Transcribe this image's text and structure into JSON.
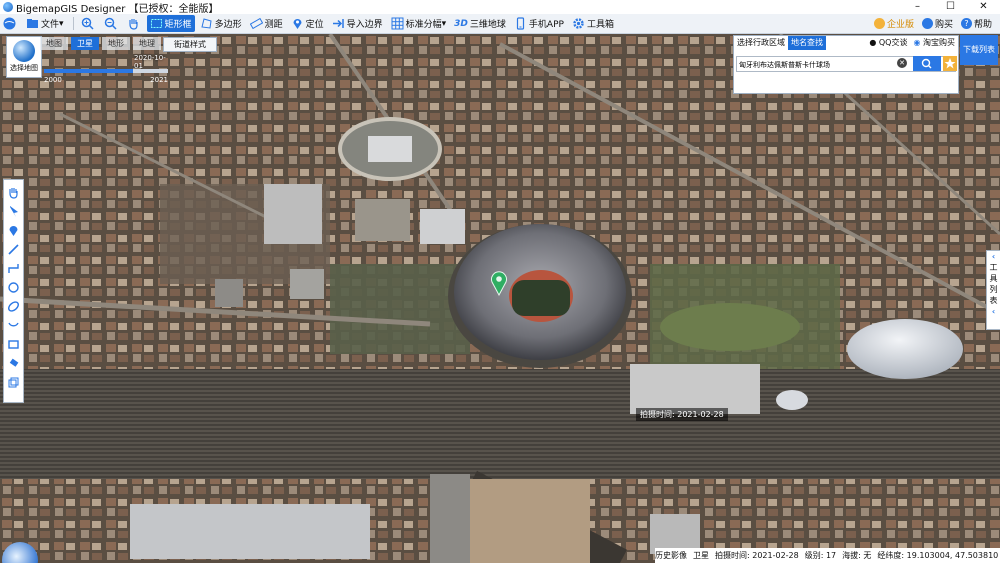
{
  "app": {
    "title": "BigemapGIS Designer 【已授权：全能版】",
    "window_buttons": [
      "–",
      "☐",
      "✕"
    ]
  },
  "toolbar": {
    "file_menu": "文件",
    "items": {
      "rect_select": "矩形框",
      "polygon": "多边形",
      "measure": "测距",
      "locate": "定位",
      "import_boundary": "导入边界",
      "standard_grid": "标准分幅",
      "three_d_label": "3D",
      "three_d": "三维地球",
      "mobile_app": "手机APP",
      "toolbox": "工具箱"
    },
    "right": {
      "enterprise": "企业版",
      "qq": "购买",
      "help": "帮助"
    }
  },
  "map": {
    "switch_label": "选择地图",
    "types": [
      "地图",
      "卫星",
      "地形",
      "地理"
    ],
    "active_type": "卫星",
    "street_style": "街道样式",
    "timeline": {
      "date": "2020-10-01",
      "start": "2000",
      "end": "2021",
      "progress": 0.72
    },
    "capture_label": "拍摄时间: 2021-02-28",
    "compass_label": "3D"
  },
  "search": {
    "tab_region": "选择行政区域",
    "tab_place": "地名查找",
    "qq_label": "QQ交谈",
    "shop_label": "淘宝购买",
    "query": "匈牙利布达佩斯普斯卡什球场"
  },
  "download_list": "下载列表",
  "layers_panel": {
    "label_chars": [
      "工",
      "具",
      "列",
      "表"
    ]
  },
  "status": {
    "history": "历史影像",
    "imagery": "卫星",
    "capture_time": "拍摄时间: 2021-02-28",
    "level": "级别: 17",
    "altitude": "海拔: 无",
    "coords": "经纬度: 19.103004, 47.503810"
  },
  "colors": {
    "accent": "#1e6fd9",
    "star": "#f3b23a",
    "pin": "#2fae63"
  }
}
